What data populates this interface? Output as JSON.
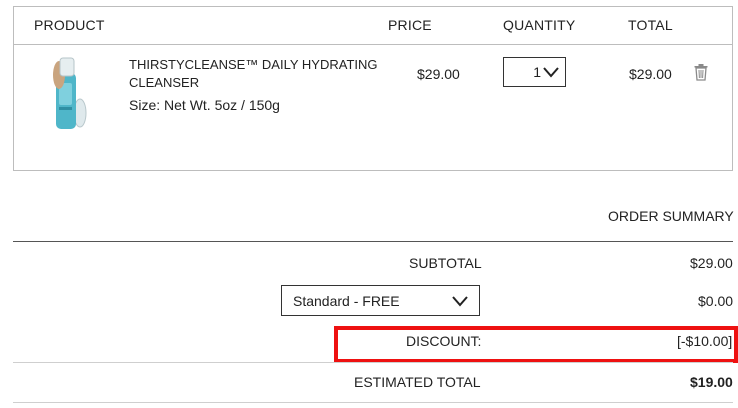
{
  "cart": {
    "headers": {
      "product": "PRODUCT",
      "price": "PRICE",
      "quantity": "QUANTITY",
      "total": "TOTAL"
    },
    "item": {
      "name_line1": "THIRSTYCLEANSE™ DAILY HYDRATING",
      "name_line2": "CLEANSER",
      "size": "Size: Net Wt. 5oz / 150g",
      "price": "$29.00",
      "quantity": "1",
      "total": "$29.00",
      "image_icon": "product-bottle-icon",
      "remove_icon": "trash-icon"
    }
  },
  "summary": {
    "title": "ORDER SUMMARY",
    "subtotal_label": "SUBTOTAL",
    "subtotal_value": "$29.00",
    "shipping_option": "Standard - FREE",
    "shipping_value": "$0.00",
    "discount_label": "DISCOUNT:",
    "discount_value": "[-$10.00]",
    "estimated_total_label": "ESTIMATED TOTAL",
    "estimated_total_value": "$19.00"
  },
  "colors": {
    "highlight": "#ee1111",
    "border": "#bdbdbd",
    "text": "#222222"
  }
}
